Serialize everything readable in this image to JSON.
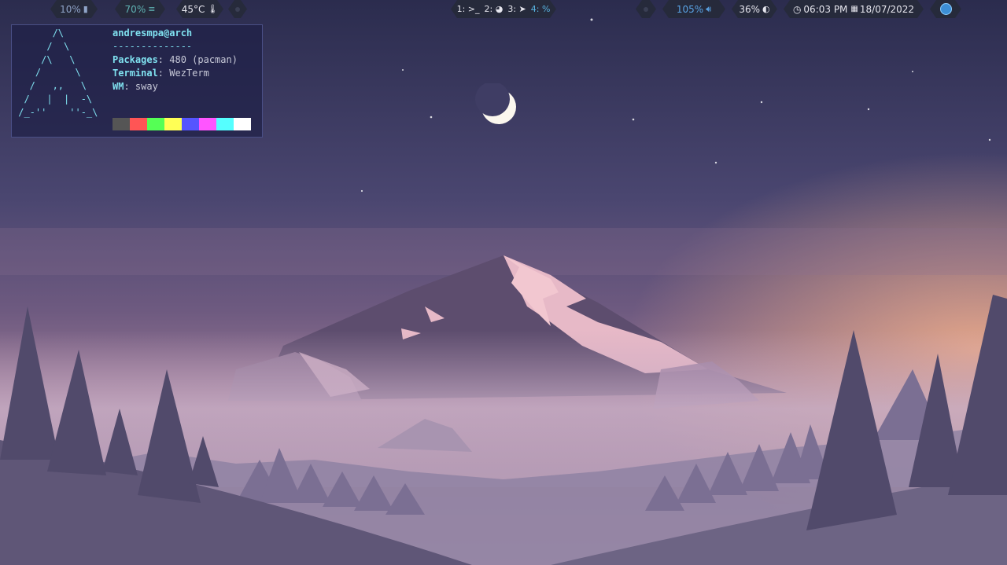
{
  "bar": {
    "left": {
      "battery_text": "10%",
      "memory_text": "70%",
      "temperature_text": "45°C"
    },
    "workspaces": [
      {
        "label": "1: >_"
      },
      {
        "label": "2:"
      },
      {
        "label": "3:"
      },
      {
        "label": "4: %"
      }
    ],
    "right": {
      "volume_text": "105%",
      "brightness_text": "36%",
      "time_text": "06:03 PM",
      "date_text": "18/07/2022"
    }
  },
  "neofetch": {
    "ascii_lines": [
      "       /\\",
      "      /  \\",
      "     /\\   \\",
      "    /      \\",
      "   /   ,,   \\",
      "  /   |  |  -\\",
      " /_-''    ''-_\\"
    ],
    "user": "andresmpa@arch",
    "separator": "--------------",
    "packages_key": "Packages",
    "packages_value": "480 (pacman)",
    "terminal_key": "Terminal",
    "terminal_value": "WezTerm",
    "wm_key": "WM",
    "wm_value": "sway",
    "palette": [
      "#555555",
      "#ff5555",
      "#55ff55",
      "#ffff55",
      "#5555ff",
      "#ff55ff",
      "#55ffff",
      "#ffffff"
    ]
  },
  "colors": {
    "bar_bg": "#262a3b",
    "accent_teal": "#5fb3b3",
    "accent_blue": "#58b3e0"
  }
}
